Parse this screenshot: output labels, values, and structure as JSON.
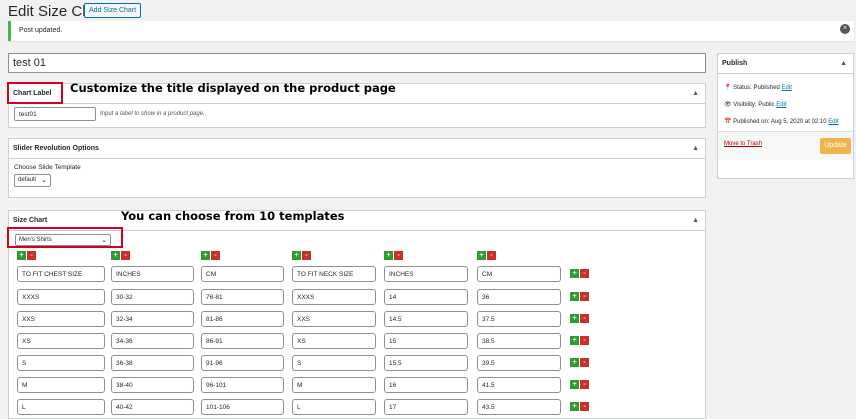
{
  "page": {
    "title": "Edit Size Chart",
    "add_button": "Add Size Chart"
  },
  "notice": {
    "text": "Post updated."
  },
  "post_title": "test 01",
  "chart_label_box": {
    "title": "Chart Label",
    "input_value": "test01",
    "hint": "Input a label to show in a product page.",
    "annotation": "Customize the title displayed on the product page"
  },
  "slider_box": {
    "title": "Slider Revolution Options",
    "label": "Choose Slide Template",
    "selected": "default"
  },
  "size_chart_box": {
    "title": "Size Chart",
    "template_selected": "Men's Shirts",
    "annotation": "You can choose from 10 templates",
    "headers": [
      "TO FIT CHEST SIZE",
      "INCHES",
      "CM",
      "TO FIT NECK SIZE",
      "INCHES",
      "CM"
    ],
    "rows": [
      [
        "XXXS",
        "30-32",
        "76-81",
        "XXXS",
        "14",
        "36"
      ],
      [
        "XXS",
        "32-34",
        "81-86",
        "XXS",
        "14.5",
        "37.5"
      ],
      [
        "XS",
        "34-36",
        "86-91",
        "XS",
        "15",
        "38.5"
      ],
      [
        "S",
        "36-38",
        "91-96",
        "S",
        "15.5",
        "39.5"
      ],
      [
        "M",
        "38-40",
        "96-101",
        "M",
        "16",
        "41.5"
      ],
      [
        "L",
        "40-42",
        "101-106",
        "L",
        "17",
        "43.5"
      ]
    ]
  },
  "publish": {
    "title": "Publish",
    "status_label": "Status:",
    "status_value": "Published",
    "status_edit": "Edit",
    "visibility_label": "Visibility:",
    "visibility_value": "Public",
    "visibility_edit": "Edit",
    "published_label": "Published on:",
    "published_value": "Aug 5, 2020 at 02:10",
    "published_edit": "Edit",
    "trash": "Move to Trash",
    "update": "Update"
  },
  "icons": {
    "arrow": "triangle-up",
    "plus": "+",
    "minus": "-",
    "close": "×"
  }
}
